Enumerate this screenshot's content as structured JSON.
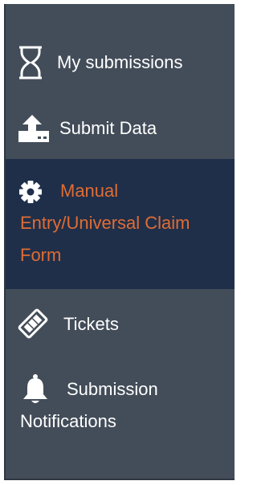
{
  "sidebar": {
    "colors": {
      "panel_bg": "#434d59",
      "active_bg": "#1f2f4a",
      "active_text": "#e06c33",
      "text": "#ffffff"
    },
    "items": [
      {
        "label": "My submissions",
        "icon": "hourglass-icon",
        "active": false
      },
      {
        "label": "Submit Data",
        "icon": "upload-icon",
        "active": false
      },
      {
        "label_line1": "Manual",
        "label_line2": "Entry/Universal Claim",
        "label_line3": "Form",
        "icon": "gear-icon",
        "active": true
      },
      {
        "label": "Tickets",
        "icon": "ticket-icon",
        "active": false
      },
      {
        "label_line1": "Submission",
        "label_line2": "Notifications",
        "icon": "bell-icon",
        "active": false
      }
    ]
  }
}
